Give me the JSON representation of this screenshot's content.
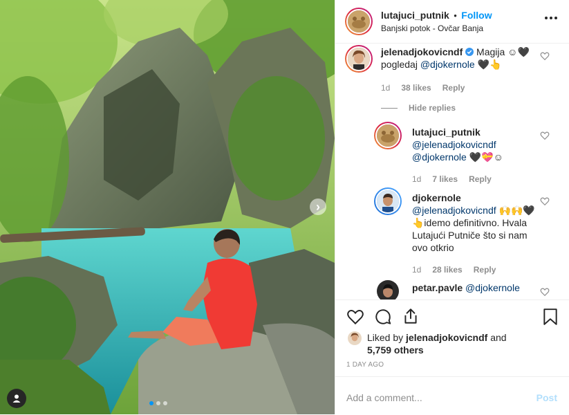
{
  "post": {
    "username": "lutajuci_putnik",
    "separator": "•",
    "follow_label": "Follow",
    "location": "Banjski potok - Ovčar Banja",
    "more_icon": "more-options-icon"
  },
  "comments": [
    {
      "username": "jelenadjokovicndf",
      "verified": true,
      "text_line1": "Magija ☺🖤",
      "text_line2_prefix": "pogledaj",
      "mention": "@djokernole",
      "text_line2_suffix": "🖤👆",
      "time": "1d",
      "likes": "38 likes",
      "reply": "Reply",
      "hide_replies": "Hide replies"
    }
  ],
  "replies": [
    {
      "username": "lutajuci_putnik",
      "mention1": "@jelenadjokovicndf",
      "mention2": "@djokernole",
      "suffix": "🖤💝☺",
      "time": "1d",
      "likes": "7 likes",
      "reply": "Reply"
    },
    {
      "username": "djokernole",
      "mention1": "@jelenadjokovicndf",
      "suffix1": "🙌🙌🖤",
      "line2": "👆idemo definitivno. Hvala",
      "line3": "Lutajući Putniče što si nam",
      "line4": "ovo otkrio",
      "time": "1d",
      "likes": "28 likes",
      "reply": "Reply"
    },
    {
      "username": "petar.pavle",
      "mention1": "@djokernole"
    }
  ],
  "likes": {
    "prefix": "Liked by",
    "liker": "jelenadjokovicndf",
    "conj": "and",
    "others": "5,759 others"
  },
  "time_ago": "1 DAY AGO",
  "add_comment": {
    "placeholder": "Add a comment...",
    "post_label": "Post"
  },
  "colors": {
    "link": "#00376b",
    "follow": "#0095f6",
    "post_disabled": "#b2dffc",
    "meta": "#8e8e8e"
  }
}
